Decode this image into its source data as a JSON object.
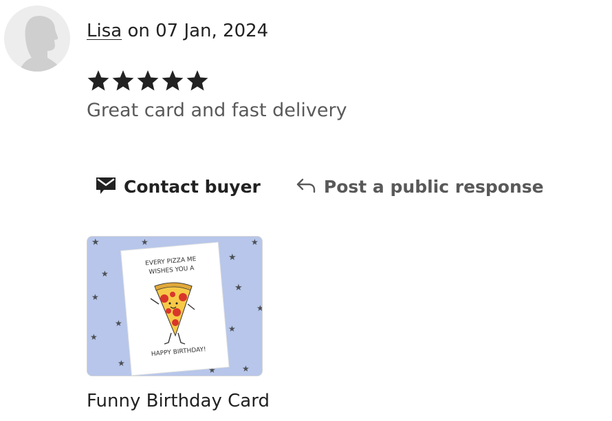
{
  "review": {
    "reviewer_name": "Lisa",
    "date_text": " on 07 Jan, 2024",
    "rating": 5,
    "rating_max": 5,
    "text": "Great card and fast delivery"
  },
  "actions": {
    "contact_label": "Contact buyer",
    "contact_icon": "envelope-icon",
    "respond_label": "Post a public response",
    "respond_icon": "reply-arrow-icon"
  },
  "product": {
    "title": "Funny Birthday Card",
    "image_card_line1": "EVERY PIZZA ME",
    "image_card_line2": "WISHES YOU A",
    "image_card_line3": "HAPPY BIRTHDAY!"
  },
  "colors": {
    "text_primary": "#222222",
    "text_secondary": "#595959",
    "star": "#222222",
    "avatar_bg": "#ededed",
    "avatar_silhouette": "#cfcfcf",
    "image_bg": "#b7c6ea"
  }
}
